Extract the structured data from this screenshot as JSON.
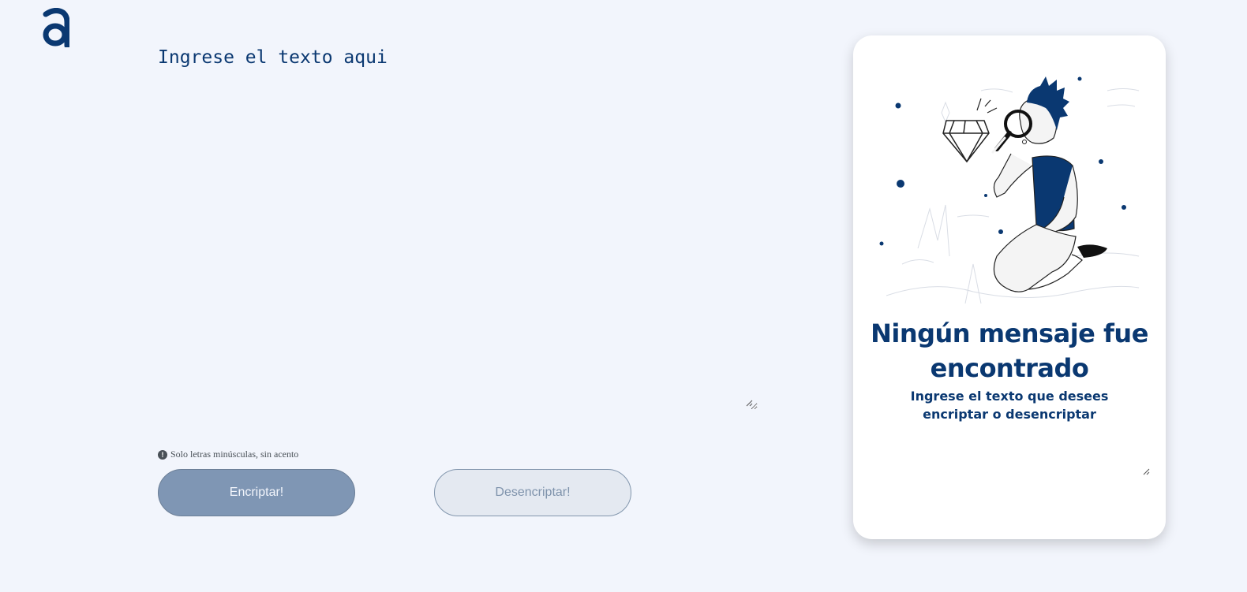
{
  "app": {
    "logo_icon": "brand-a-logo"
  },
  "input": {
    "placeholder": "Ingrese el texto aqui",
    "value": ""
  },
  "hint": {
    "icon": "exclamation-circle-icon",
    "text": "Solo letras minúsculas, sin acento"
  },
  "buttons": {
    "encrypt_label": "Encriptar!",
    "decrypt_label": "Desencriptar!"
  },
  "output": {
    "illustration": "person-with-magnifying-glass-and-diamond",
    "title": "Ningún mensaje fue encontrado",
    "subtitle": "Ingrese el texto que desees encriptar o desencriptar",
    "value": ""
  },
  "colors": {
    "primary": "#0a3871",
    "background": "#f2f5fc",
    "card": "#ffffff",
    "button_primary": "#7f96b4",
    "button_secondary": "#e4e9f1"
  }
}
